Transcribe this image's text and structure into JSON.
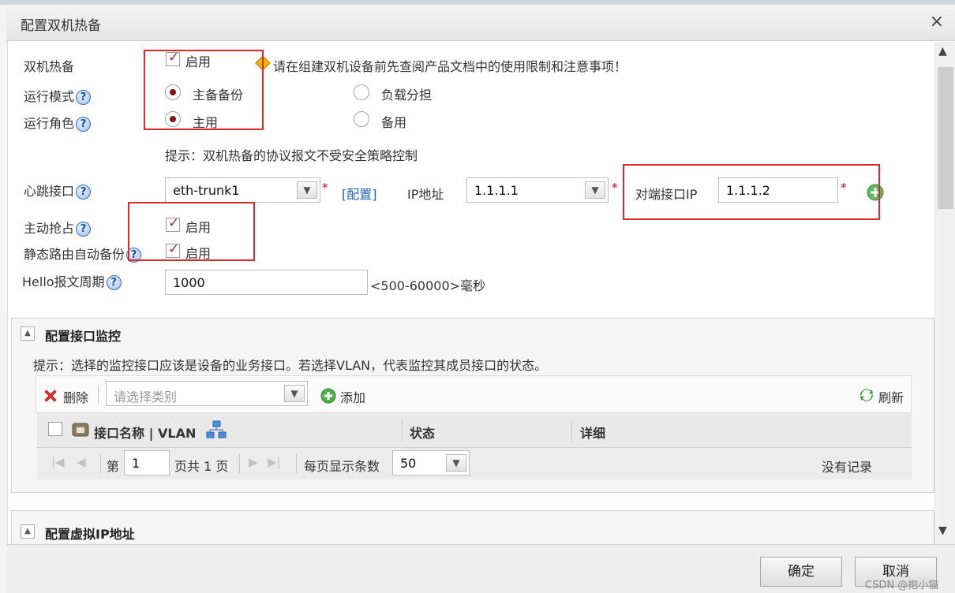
{
  "dialog": {
    "title": "配置双机热备",
    "close": "×"
  },
  "form": {
    "ha": {
      "label": "双机热备",
      "checkbox_label": "启用",
      "notice": "请在组建双机设备前先查阅产品文档中的使用限制和注意事项！"
    },
    "run_mode": {
      "label": "运行模式",
      "options": [
        "主备备份",
        "负载分担"
      ],
      "selected": "主备备份"
    },
    "run_role": {
      "label": "运行角色",
      "options": [
        "主用",
        "备用"
      ],
      "selected": "主用"
    },
    "hint": "提示：双机热备的协议报文不受安全策略控制",
    "heartbeat": {
      "label": "心跳接口",
      "value": "eth-trunk1",
      "config_link": "[配置]",
      "ip_label": "IP地址",
      "ip_value": "1.1.1.1",
      "peer_label": "对端接口IP",
      "peer_value": "1.1.1.2",
      "required": "*"
    },
    "preempt": {
      "label": "主动抢占",
      "checkbox_label": "启用"
    },
    "static_route": {
      "label": "静态路由自动备份",
      "checkbox_label": "启用"
    },
    "hello": {
      "label": "Hello报文周期",
      "value": "1000",
      "range": "<500-60000>毫秒"
    }
  },
  "monitor": {
    "title": "配置接口监控",
    "hint": "提示：选择的监控接口应该是设备的业务接口。若选择VLAN，代表监控其成员接口的状态。",
    "toolbar": {
      "delete": "删除",
      "category_placeholder": "请选择类别",
      "add": "添加",
      "refresh": "刷新"
    },
    "columns": [
      "接口名称 | VLAN",
      "状态",
      "详细"
    ],
    "pager": {
      "page_prefix": "第",
      "page": "1",
      "page_suffix": "页共 1 页",
      "per_page_label": "每页显示条数",
      "per_page": "50",
      "empty": "没有记录"
    }
  },
  "virtual_ip": {
    "title": "配置虚拟IP地址"
  },
  "footer": {
    "ok": "确定",
    "cancel": "取消",
    "watermark": "CSDN @抱小猫"
  },
  "colors": {
    "accent_red": "#e1262c",
    "link": "#1f62c1",
    "required": "#d0021b"
  }
}
